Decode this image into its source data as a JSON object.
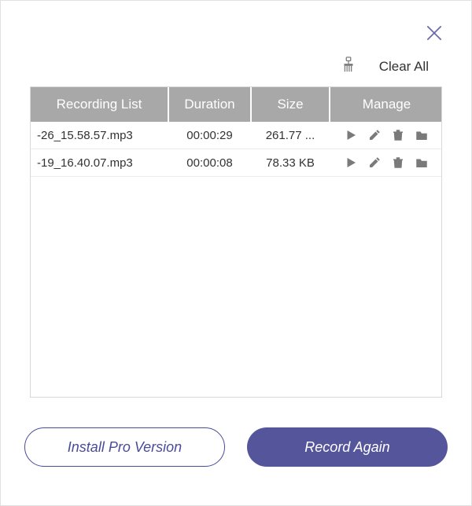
{
  "close_label": "Close",
  "toolbar": {
    "clear_all_label": "Clear All"
  },
  "table": {
    "headers": {
      "recording_list": "Recording List",
      "duration": "Duration",
      "size": "Size",
      "manage": "Manage"
    },
    "rows": [
      {
        "name": "-26_15.58.57.mp3",
        "duration": "00:00:29",
        "size": "261.77 ..."
      },
      {
        "name": "-19_16.40.07.mp3",
        "duration": "00:00:08",
        "size": "78.33 KB"
      }
    ]
  },
  "buttons": {
    "install_pro": "Install Pro Version",
    "record_again": "Record Again"
  }
}
